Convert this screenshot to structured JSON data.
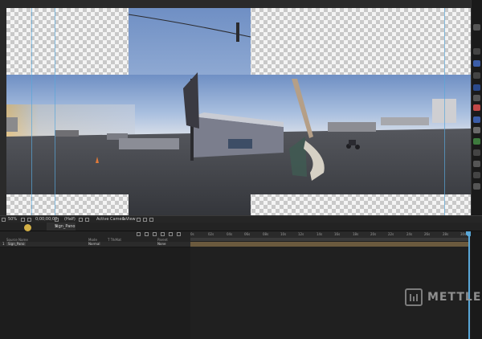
{
  "viewer": {
    "zoom": "50%",
    "timecode": "0;00;00;00",
    "resolution": "(Half)",
    "camera": "Active Camera",
    "views": "1 View"
  },
  "timeline": {
    "comp_tab": "Sign_Pano",
    "tab_close": "×",
    "columns": {
      "source_name": "Source Name",
      "mode": "Mode",
      "trkmat": "T TrkMat",
      "parent": "Parent"
    },
    "layer": {
      "number": "1",
      "name": "Sign_Pano",
      "mode": "Normal",
      "parent": "None"
    },
    "ruler_labels": [
      "0s",
      "02s",
      "04s",
      "06s",
      "08s",
      "10s",
      "12s",
      "14s",
      "16s",
      "18s",
      "20s",
      "22s",
      "24s",
      "26s",
      "28s",
      "30s"
    ]
  },
  "watermark": {
    "text": "METTLE"
  },
  "colors": {
    "guide": "#5aa7d8",
    "playhead": "#5aa7d8",
    "layer_bar": "#6b5a3e",
    "sky": "#7fa0cf",
    "ground": "#3c3e44"
  },
  "icons": [
    "play-icon",
    "camera-icon",
    "grid-icon",
    "mask-icon",
    "stopwatch-icon",
    "eye-icon",
    "lock-icon"
  ]
}
